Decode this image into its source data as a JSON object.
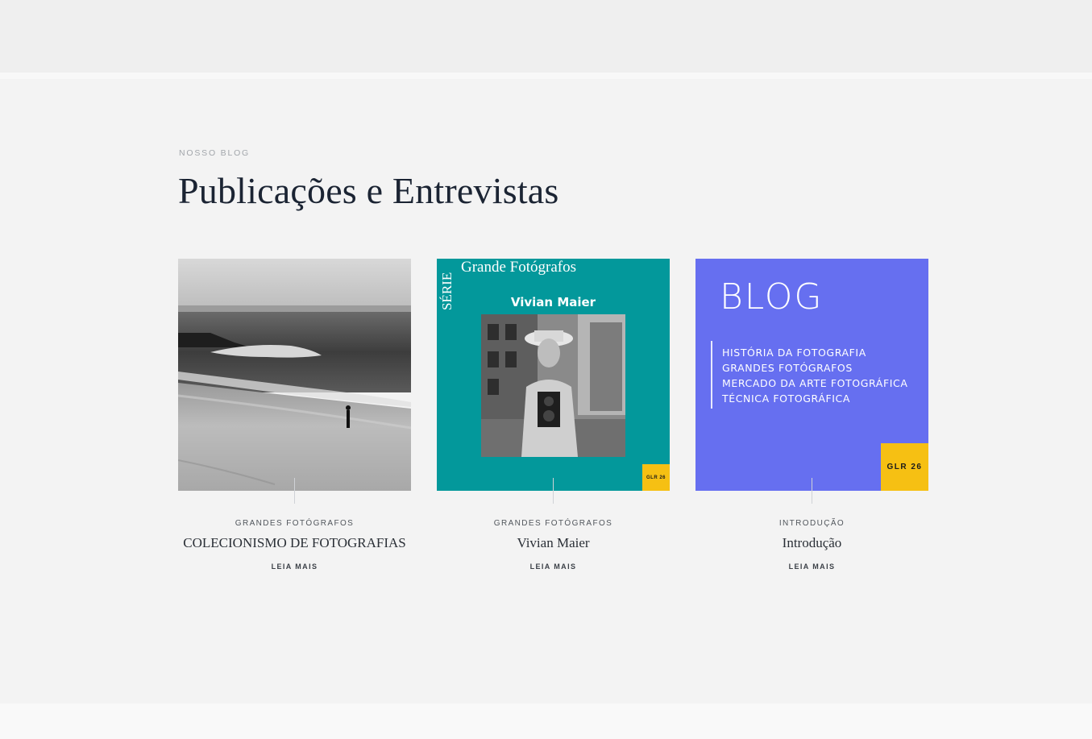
{
  "section": {
    "eyebrow": "NOSSO BLOG",
    "title": "Publicações e Entrevistas"
  },
  "cards": [
    {
      "category": "GRANDES FOTÓGRAFOS",
      "title": "COLECIONISMO DE FOTOGRAFIAS",
      "link": "LEIA MAIS",
      "image": "beach-photo"
    },
    {
      "category": "GRANDES FOTÓGRAFOS",
      "title": "Vivian Maier",
      "link": "LEIA MAIS",
      "image": {
        "series_vertical": "SÉRIE",
        "series_title": "Grande Fotógrafos",
        "subject": "Vivian Maier",
        "badge": "GLR 26"
      }
    },
    {
      "category": "INTRODUÇÃO",
      "title": "Introdução",
      "link": "LEIA MAIS",
      "image": {
        "heading": "BLOG",
        "topics": [
          "HISTÓRIA DA FOTOGRAFIA",
          "GRANDES FOTÓGRAFOS",
          "MERCADO DA ARTE FOTOGRÁFICA",
          "TÉCNICA FOTOGRÁFICA"
        ],
        "badge": "GLR 26"
      }
    }
  ],
  "colors": {
    "teal": "#03989b",
    "blue": "#666ff0",
    "badge": "#f6c013",
    "headline": "#1b2433"
  }
}
